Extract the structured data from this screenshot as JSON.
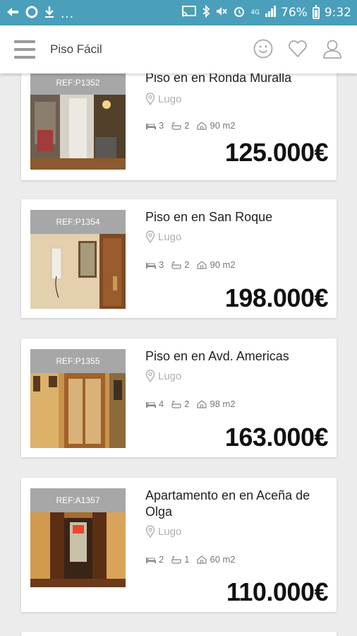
{
  "status_bar": {
    "notif_dots": "...",
    "network": "4G",
    "battery": "76%",
    "battery_level": 0.76,
    "time": "9:32"
  },
  "app": {
    "title": "Piso Fácil"
  },
  "listings": [
    {
      "ref": "REF:P1352",
      "title": "Piso en en Ronda Muralla",
      "location": "Lugo",
      "beds": "3",
      "baths": "2",
      "area": "90 m2",
      "price": "125.000€"
    },
    {
      "ref": "REF:P1354",
      "title": "Piso en en San Roque",
      "location": "Lugo",
      "beds": "3",
      "baths": "2",
      "area": "90 m2",
      "price": "198.000€"
    },
    {
      "ref": "REF:P1355",
      "title": "Piso en en Avd. Americas",
      "location": "Lugo",
      "beds": "4",
      "baths": "2",
      "area": "98 m2",
      "price": "163.000€"
    },
    {
      "ref": "REF:A1357",
      "title": "Apartamento en en Aceña de Olga",
      "location": "Lugo",
      "beds": "2",
      "baths": "1",
      "area": "60 m2",
      "price": "110.000€"
    }
  ]
}
